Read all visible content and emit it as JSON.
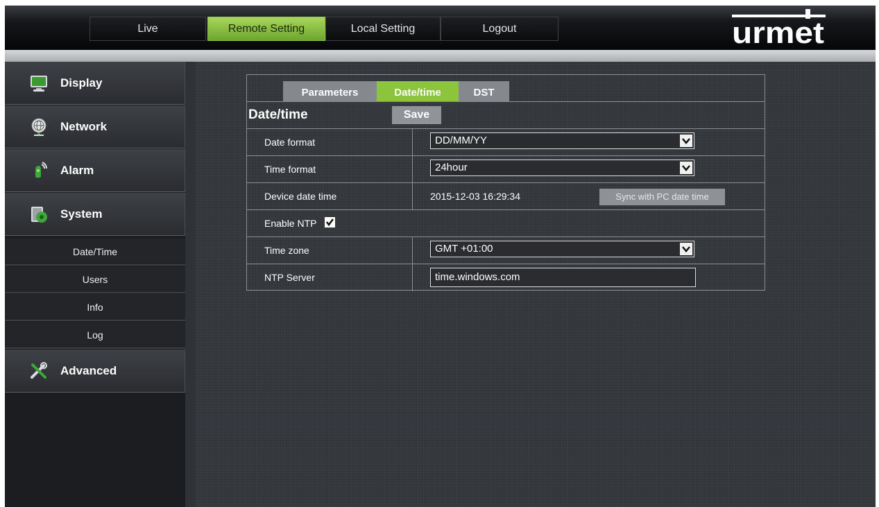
{
  "nav": {
    "tabs": [
      {
        "label": "Live"
      },
      {
        "label": "Remote Setting",
        "active": true
      },
      {
        "label": "Local Setting"
      },
      {
        "label": "Logout"
      }
    ],
    "brand": "urmet"
  },
  "sidebar": {
    "menu": [
      {
        "label": "Display",
        "icon": "monitor-icon"
      },
      {
        "label": "Network",
        "icon": "globe-icon"
      },
      {
        "label": "Alarm",
        "icon": "alarm-icon"
      },
      {
        "label": "System",
        "icon": "system-gear-icon"
      },
      {
        "label": "Advanced",
        "icon": "tools-icon"
      }
    ],
    "system_submenu": [
      {
        "label": "Date/Time"
      },
      {
        "label": "Users"
      },
      {
        "label": "Info"
      },
      {
        "label": "Log"
      }
    ]
  },
  "panel": {
    "subtabs": [
      {
        "label": "Parameters"
      },
      {
        "label": "Date/time",
        "active": true
      },
      {
        "label": "DST"
      }
    ],
    "section_title": "Date/time",
    "save_label": "Save",
    "rows": {
      "date_format": {
        "label": "Date format",
        "value": "DD/MM/YY"
      },
      "time_format": {
        "label": "Time format",
        "value": "24hour"
      },
      "device_datetime": {
        "label": "Device date time",
        "value": "2015-12-03 16:29:34",
        "sync_label": "Sync with PC date time"
      },
      "enable_ntp": {
        "label": "Enable NTP",
        "checked": true
      },
      "time_zone": {
        "label": "Time zone",
        "value": "GMT +01:00"
      },
      "ntp_server": {
        "label": "NTP Server",
        "value": "time.windows.com"
      }
    }
  },
  "colors": {
    "accent_green": "#8cc43c",
    "background": "#33363b"
  }
}
